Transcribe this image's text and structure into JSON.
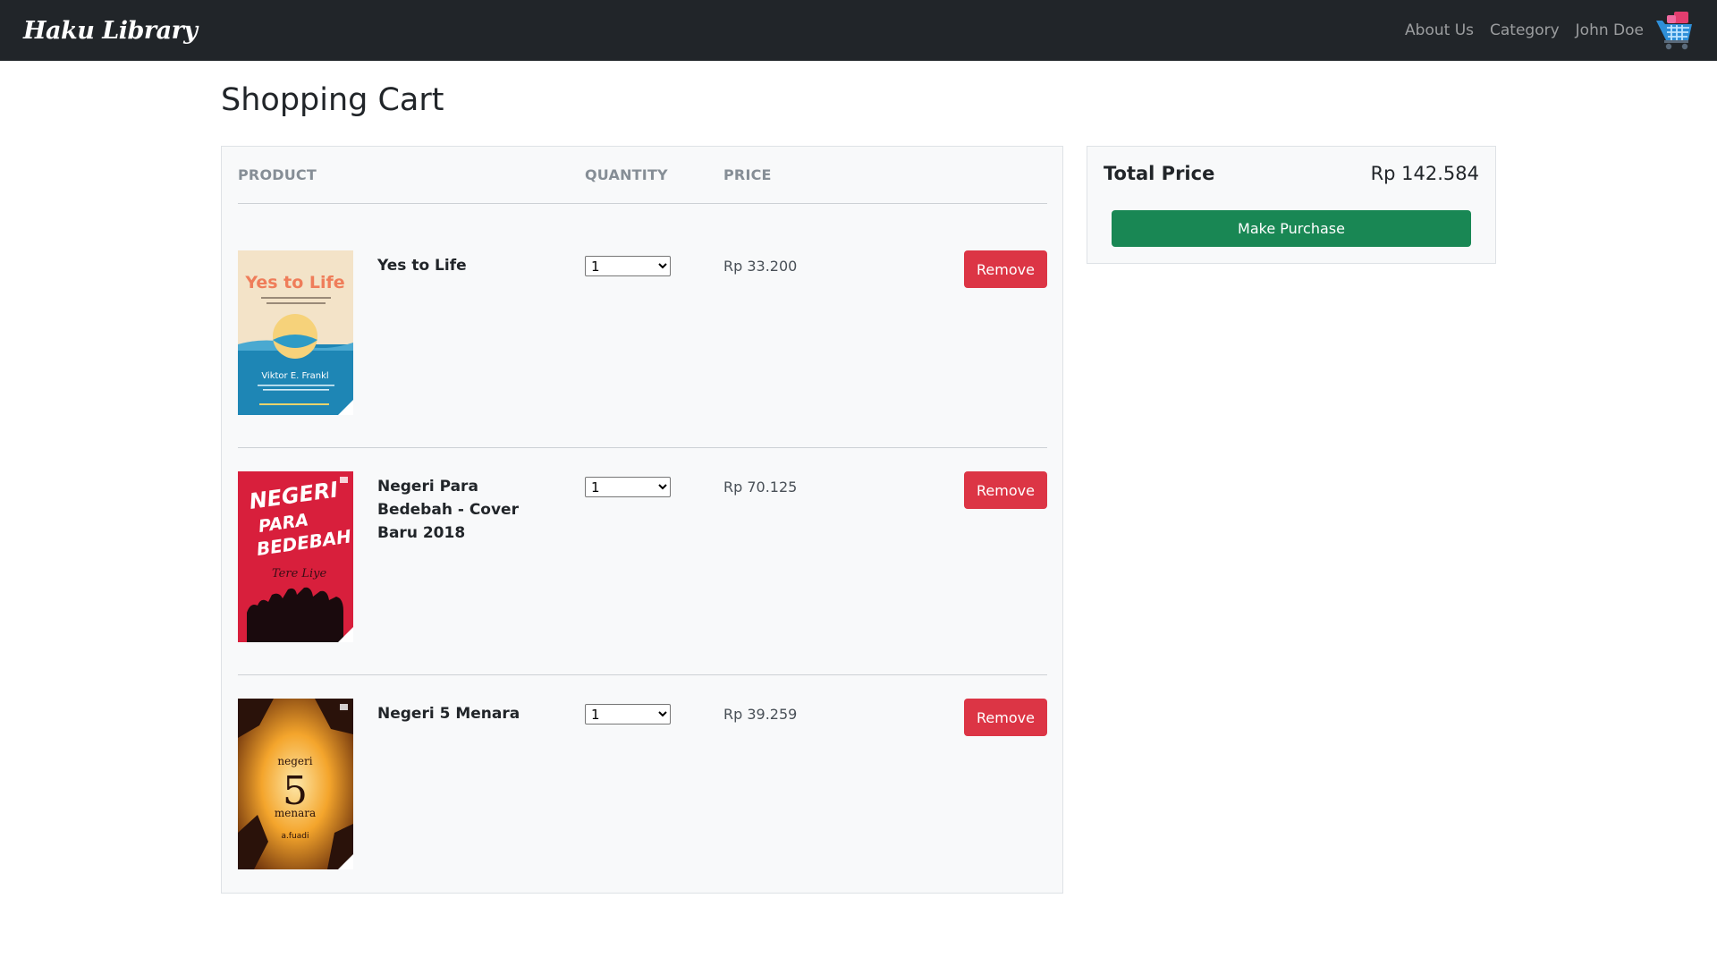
{
  "navbar": {
    "brand": "Haku Library",
    "links": [
      "About Us",
      "Category",
      "John Doe"
    ],
    "cart_icon": "shopping-cart-icon"
  },
  "page": {
    "title": "Shopping Cart"
  },
  "cart": {
    "headers": {
      "product": "PRODUCT",
      "quantity": "QUANTITY",
      "price": "PRICE"
    },
    "items": [
      {
        "title": "Yes to Life",
        "quantity": "1",
        "price": "Rp 33.200",
        "remove_label": "Remove",
        "cover": {
          "title": "Yes to Life",
          "author": "Viktor E. Frankl",
          "colors": [
            "#f1dcc0",
            "#1f8ab3"
          ]
        }
      },
      {
        "title": "Negeri Para Bedebah - Cover Baru 2018",
        "quantity": "1",
        "price": "Rp 70.125",
        "remove_label": "Remove",
        "cover": {
          "title": "NEGERI PARA BEDEBAH",
          "author": "Tere Liye",
          "colors": [
            "#d81f3c"
          ]
        }
      },
      {
        "title": "Negeri 5 Menara",
        "quantity": "1",
        "price": "Rp 39.259",
        "remove_label": "Remove",
        "cover": {
          "title": "negeri 5 menara",
          "author": "a.fuadi",
          "colors": [
            "#f4a52c",
            "#3a1a12"
          ]
        }
      }
    ]
  },
  "summary": {
    "total_label": "Total Price",
    "total_value": "Rp 142.584",
    "purchase_label": "Make Purchase"
  },
  "colors": {
    "navbar": "#212529",
    "danger": "#dc3545",
    "success": "#198754",
    "panel": "#f8f9fa"
  }
}
